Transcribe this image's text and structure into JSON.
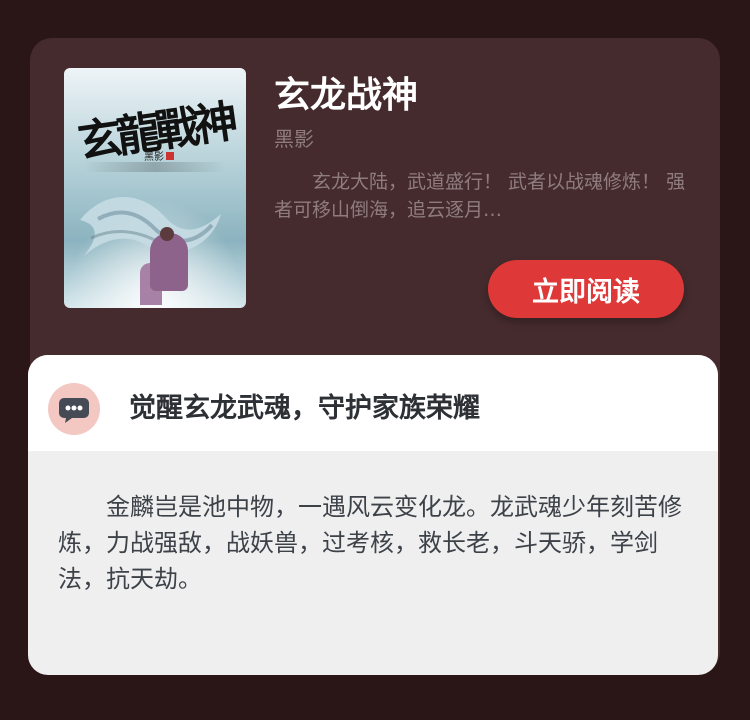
{
  "book": {
    "title": "玄龙战神",
    "author": "黑影",
    "summary": "玄龙大陆，武道盛行！ 武者以战魂修炼！ 强者可移山倒海，追云逐月…",
    "read_button_label": "立即阅读",
    "cover": {
      "title": "玄龍戰神",
      "author": "黑影"
    }
  },
  "intro": {
    "headline": "觉醒玄龙武魂，守护家族荣耀",
    "body": "金麟岂是池中物，一遇风云变化龙。龙武魂少年刻苦修炼，力战强敌，战妖兽，过考核，救长老，斗天骄，学剑法，抗天劫。"
  },
  "colors": {
    "background": "#2a1517",
    "card": "#452b2d",
    "accent": "#df3838",
    "icon_bg": "#f3c8c3"
  },
  "icons": {
    "chat": "chat-bubble-dots-icon"
  }
}
